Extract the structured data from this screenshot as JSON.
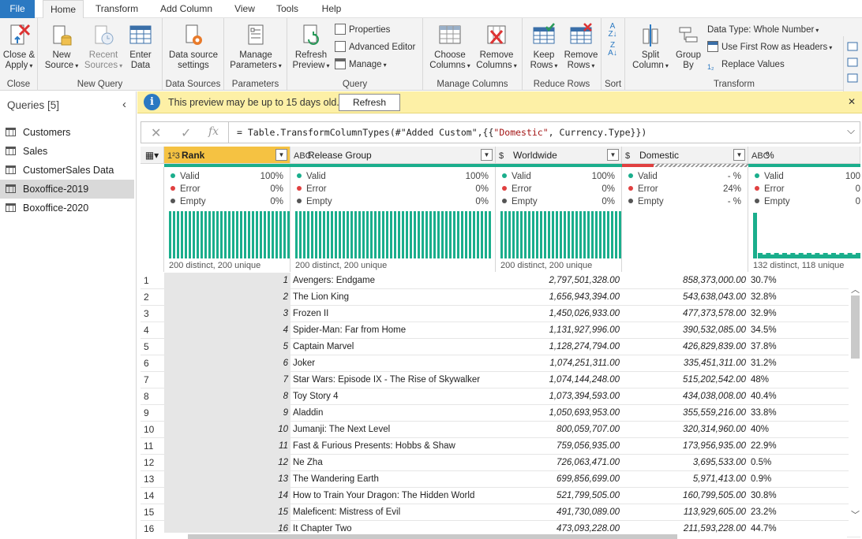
{
  "menu": {
    "tabs": [
      "File",
      "Home",
      "Transform",
      "Add Column",
      "View",
      "Tools",
      "Help"
    ],
    "active": "Home"
  },
  "ribbon": {
    "close": {
      "btn": "Close &",
      "btn2": "Apply",
      "label": "Close"
    },
    "new_query": {
      "new_source": "New",
      "new_source2": "Source",
      "recent": "Recent",
      "recent2": "Sources",
      "enter": "Enter",
      "enter2": "Data",
      "label": "New Query"
    },
    "data_sources": {
      "btn": "Data source",
      "btn2": "settings",
      "label": "Data Sources"
    },
    "parameters": {
      "btn": "Manage",
      "btn2": "Parameters",
      "label": "Parameters"
    },
    "query": {
      "refresh": "Refresh",
      "refresh2": "Preview",
      "properties": "Properties",
      "advanced": "Advanced Editor",
      "manage": "Manage",
      "label": "Query"
    },
    "manage_columns": {
      "choose": "Choose",
      "choose2": "Columns",
      "remove": "Remove",
      "remove2": "Columns",
      "label": "Manage Columns"
    },
    "reduce_rows": {
      "keep": "Keep",
      "keep2": "Rows",
      "remove": "Remove",
      "remove2": "Rows",
      "label": "Reduce Rows"
    },
    "sort": {
      "label": "Sort"
    },
    "transform": {
      "split": "Split",
      "split2": "Column",
      "group": "Group",
      "group2": "By",
      "data_type": "Data Type: Whole Number",
      "first_row": "Use First Row as Headers",
      "replace": "Replace Values",
      "label": "Transform"
    }
  },
  "queries": {
    "header": "Queries [5]",
    "items": [
      "Customers",
      "Sales",
      "CustomerSales Data",
      "Boxoffice-2019",
      "Boxoffice-2020"
    ],
    "selected": "Boxoffice-2019"
  },
  "notice": {
    "message": "This preview may be up to 15 days old.",
    "button": "Refresh"
  },
  "formula": {
    "prefix": "= Table.TransformColumnTypes(#\"Added Custom\",{{",
    "string": "\"Domestic\"",
    "suffix": ", Currency.Type}})"
  },
  "columns": [
    {
      "type_icon": "1²3",
      "name": "Rank",
      "valid": "100%",
      "error": "0%",
      "empty": "0%",
      "footer": "200 distinct, 200 unique"
    },
    {
      "type_icon": "ABC",
      "name": "Release Group",
      "valid": "100%",
      "error": "0%",
      "empty": "0%",
      "footer": "200 distinct, 200 unique"
    },
    {
      "type_icon": "$",
      "name": "Worldwide",
      "valid": "100%",
      "error": "0%",
      "empty": "0%",
      "footer": "200 distinct, 200 unique"
    },
    {
      "type_icon": "$",
      "name": "Domestic",
      "valid": "- %",
      "error": "24%",
      "empty": "- %",
      "footer": ""
    },
    {
      "type_icon": "ABC",
      "name": "%",
      "valid": "100",
      "error": "0",
      "empty": "0",
      "footer": "132 distinct, 118 unique"
    }
  ],
  "profile_labels": {
    "valid": "Valid",
    "error": "Error",
    "empty": "Empty"
  },
  "rows": [
    {
      "n": "1",
      "rank": "1",
      "group": "Avengers: Endgame",
      "worldwide": "2,797,501,328.00",
      "domestic": "858,373,000.00",
      "pct": "30.7%"
    },
    {
      "n": "2",
      "rank": "2",
      "group": "The Lion King",
      "worldwide": "1,656,943,394.00",
      "domestic": "543,638,043.00",
      "pct": "32.8%"
    },
    {
      "n": "3",
      "rank": "3",
      "group": "Frozen II",
      "worldwide": "1,450,026,933.00",
      "domestic": "477,373,578.00",
      "pct": "32.9%"
    },
    {
      "n": "4",
      "rank": "4",
      "group": "Spider-Man: Far from Home",
      "worldwide": "1,131,927,996.00",
      "domestic": "390,532,085.00",
      "pct": "34.5%"
    },
    {
      "n": "5",
      "rank": "5",
      "group": "Captain Marvel",
      "worldwide": "1,128,274,794.00",
      "domestic": "426,829,839.00",
      "pct": "37.8%"
    },
    {
      "n": "6",
      "rank": "6",
      "group": "Joker",
      "worldwide": "1,074,251,311.00",
      "domestic": "335,451,311.00",
      "pct": "31.2%"
    },
    {
      "n": "7",
      "rank": "7",
      "group": "Star Wars: Episode IX - The Rise of Skywalker",
      "worldwide": "1,074,144,248.00",
      "domestic": "515,202,542.00",
      "pct": "48%"
    },
    {
      "n": "8",
      "rank": "8",
      "group": "Toy Story 4",
      "worldwide": "1,073,394,593.00",
      "domestic": "434,038,008.00",
      "pct": "40.4%"
    },
    {
      "n": "9",
      "rank": "9",
      "group": "Aladdin",
      "worldwide": "1,050,693,953.00",
      "domestic": "355,559,216.00",
      "pct": "33.8%"
    },
    {
      "n": "10",
      "rank": "10",
      "group": "Jumanji: The Next Level",
      "worldwide": "800,059,707.00",
      "domestic": "320,314,960.00",
      "pct": "40%"
    },
    {
      "n": "11",
      "rank": "11",
      "group": "Fast & Furious Presents: Hobbs & Shaw",
      "worldwide": "759,056,935.00",
      "domestic": "173,956,935.00",
      "pct": "22.9%"
    },
    {
      "n": "12",
      "rank": "12",
      "group": "Ne Zha",
      "worldwide": "726,063,471.00",
      "domestic": "3,695,533.00",
      "pct": "0.5%"
    },
    {
      "n": "13",
      "rank": "13",
      "group": "The Wandering Earth",
      "worldwide": "699,856,699.00",
      "domestic": "5,971,413.00",
      "pct": "0.9%"
    },
    {
      "n": "14",
      "rank": "14",
      "group": "How to Train Your Dragon: The Hidden World",
      "worldwide": "521,799,505.00",
      "domestic": "160,799,505.00",
      "pct": "30.8%"
    },
    {
      "n": "15",
      "rank": "15",
      "group": "Maleficent: Mistress of Evil",
      "worldwide": "491,730,089.00",
      "domestic": "113,929,605.00",
      "pct": "23.2%"
    },
    {
      "n": "16",
      "rank": "16",
      "group": "It Chapter Two",
      "worldwide": "473,093,228.00",
      "domestic": "211,593,228.00",
      "pct": "44.7%"
    }
  ]
}
